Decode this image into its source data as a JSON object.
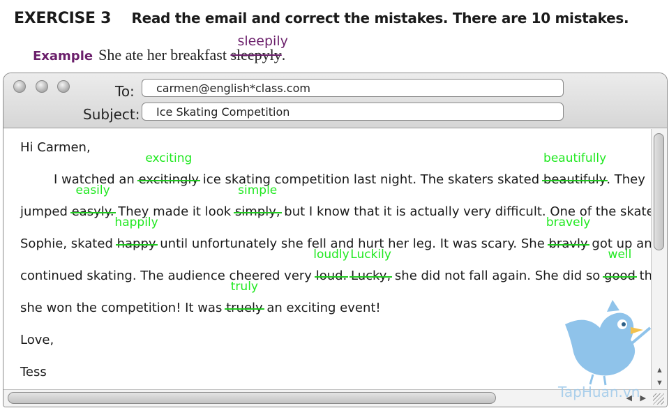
{
  "exercise": {
    "number": "EXERCISE 3",
    "instruction": "Read the email and correct the mistakes. There are 10 mistakes."
  },
  "example": {
    "label": "Example",
    "sentence_before": "She ate her breakfast ",
    "wrong": "sleepyly",
    "after": ".",
    "correction": "sleepily"
  },
  "email": {
    "to_label": "To:",
    "to_value": "carmen@english*class.com",
    "subject_label": "Subject:",
    "subject_value": "Ice Skating Competition",
    "greeting": "Hi Carmen,",
    "lines": {
      "l1": {
        "a": "I watched an ",
        "e1": "excitingly",
        "c1": "exciting",
        "b": " ice skating competition last night. The skaters skated ",
        "e2": "beautifuly",
        "c2": "beautifully",
        "c": ". They"
      },
      "l2": {
        "a": "jumped ",
        "e1": "easyly.",
        "c1": "easily",
        "b": " They made it look ",
        "e2": "simply,",
        "c2": "simple",
        "c": " but I know that it is actually very difficult. One of the skaters,"
      },
      "l3": {
        "a": "Sophie, skated ",
        "e1": "happy",
        "c1": "happily",
        "b": " until unfortunately she fell and hurt her leg. It was scary. She ",
        "e2": "bravly",
        "c2": "bravely",
        "c": " got up and"
      },
      "l4": {
        "a": "continued skating. The audience cheered very ",
        "e1": "loud.",
        "c1": "loudly",
        "m": " ",
        "e2": "Lucky,",
        "c2": "Luckily",
        "b": " she did not fall again. She did so ",
        "e3": "good",
        "c3": "well",
        "c": " that"
      },
      "l5": {
        "a": "she won the competition! It was ",
        "e1": "truely",
        "c1": "truly",
        "b": " an exciting event!"
      }
    },
    "closing": "Love,",
    "signature": "Tess"
  },
  "watermark": "TapHuan.vn",
  "colors": {
    "correction": "#1fe81f",
    "example_accent": "#6b1f6b",
    "bird": "#8fc3ea"
  }
}
